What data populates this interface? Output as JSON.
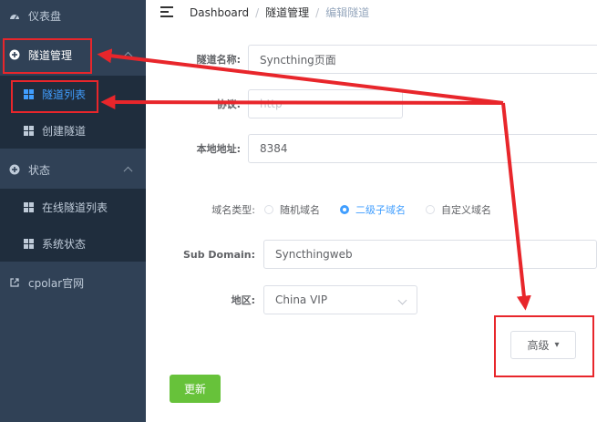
{
  "sidebar": {
    "items": [
      {
        "label": "仪表盘",
        "icon": "dashboard-icon"
      },
      {
        "label": "隧道管理",
        "icon": "tunnel-plus-icon"
      },
      {
        "label": "隧道列表",
        "icon": "grid-icon"
      },
      {
        "label": "创建隧道",
        "icon": "grid-icon"
      },
      {
        "label": "状态",
        "icon": "status-plus-icon"
      },
      {
        "label": "在线隧道列表",
        "icon": "grid-icon"
      },
      {
        "label": "系统状态",
        "icon": "grid-icon"
      },
      {
        "label": "cpolar官网",
        "icon": "external-link-icon"
      }
    ]
  },
  "breadcrumb": {
    "items": [
      "Dashboard",
      "隧道管理",
      "编辑隧道"
    ],
    "separator": "/"
  },
  "form": {
    "tunnel_name_label": "隧道名称:",
    "tunnel_name_value": "Syncthing页面",
    "protocol_label": "协议:",
    "protocol_value": "http",
    "local_addr_label": "本地地址:",
    "local_addr_value": "8384",
    "domain_type_label": "域名类型:",
    "domain_types": [
      "随机域名",
      "二级子域名",
      "自定义域名"
    ],
    "domain_type_selected": "二级子域名",
    "subdomain_label": "Sub Domain:",
    "subdomain_value": "Syncthingweb",
    "region_label": "地区:",
    "region_value": "China VIP",
    "advanced_label": "高级",
    "advanced_caret": "▾",
    "update_label": "更新"
  },
  "colors": {
    "sidebar_bg": "#304156",
    "sidebar_sub_bg": "#1f2d3d",
    "accent": "#409eff",
    "primary_button": "#67c23a",
    "annotation_red": "#e8262b"
  }
}
